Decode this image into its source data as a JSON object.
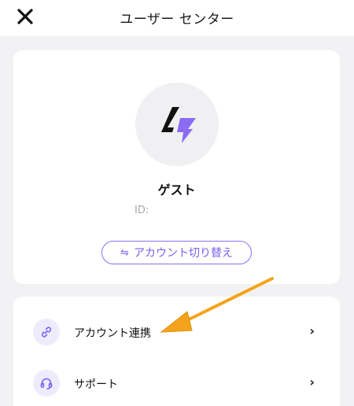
{
  "header": {
    "title": "ユーザー センター"
  },
  "profile": {
    "name": "ゲスト",
    "id_label": "ID:",
    "switch_button_label": "アカウント切り替え",
    "switch_icon": "⇋"
  },
  "menu": {
    "items": [
      {
        "label": "アカウント連携",
        "icon": "link-icon"
      },
      {
        "label": "サポート",
        "icon": "headset-icon"
      }
    ]
  },
  "colors": {
    "accent": "#7a5ff0",
    "annotation_arrow": "#f5a31a"
  }
}
